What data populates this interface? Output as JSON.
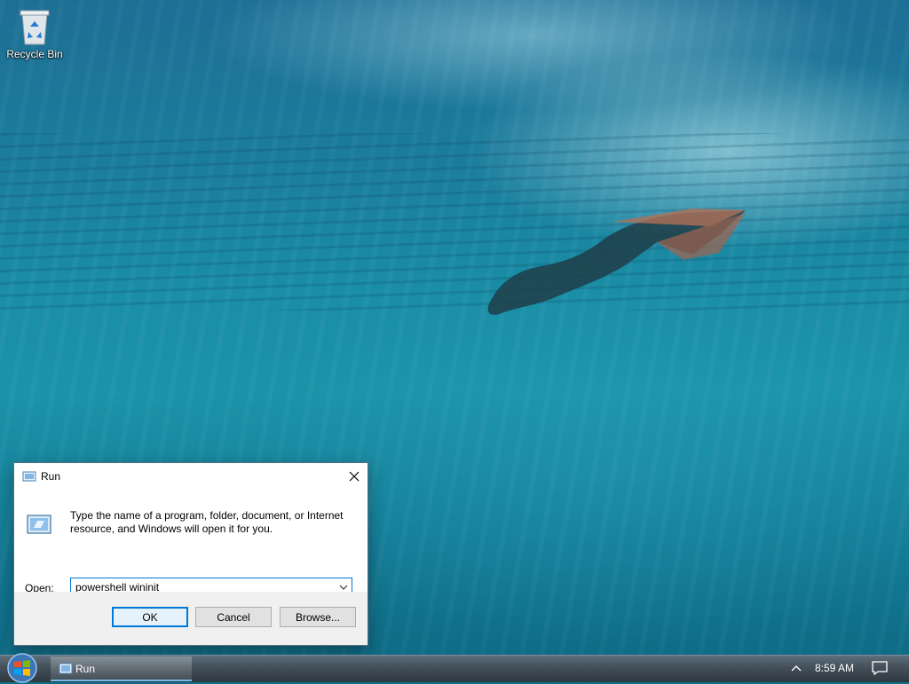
{
  "desktop": {
    "icons": [
      {
        "label": "Recycle Bin",
        "icon": "recycle-bin-icon"
      }
    ]
  },
  "run_dialog": {
    "title": "Run",
    "description": "Type the name of a program, folder, document, or Internet resource, and Windows will open it for you.",
    "open_label": "Open:",
    "input_value": "powershell wininit",
    "buttons": {
      "ok": "OK",
      "cancel": "Cancel",
      "browse": "Browse..."
    }
  },
  "taskbar": {
    "start_icon": "windows-logo-icon",
    "items": [
      {
        "label": "Run",
        "icon": "run-icon",
        "active": true
      }
    ],
    "clock": "8:59 AM",
    "accent": "#76b9ed"
  }
}
